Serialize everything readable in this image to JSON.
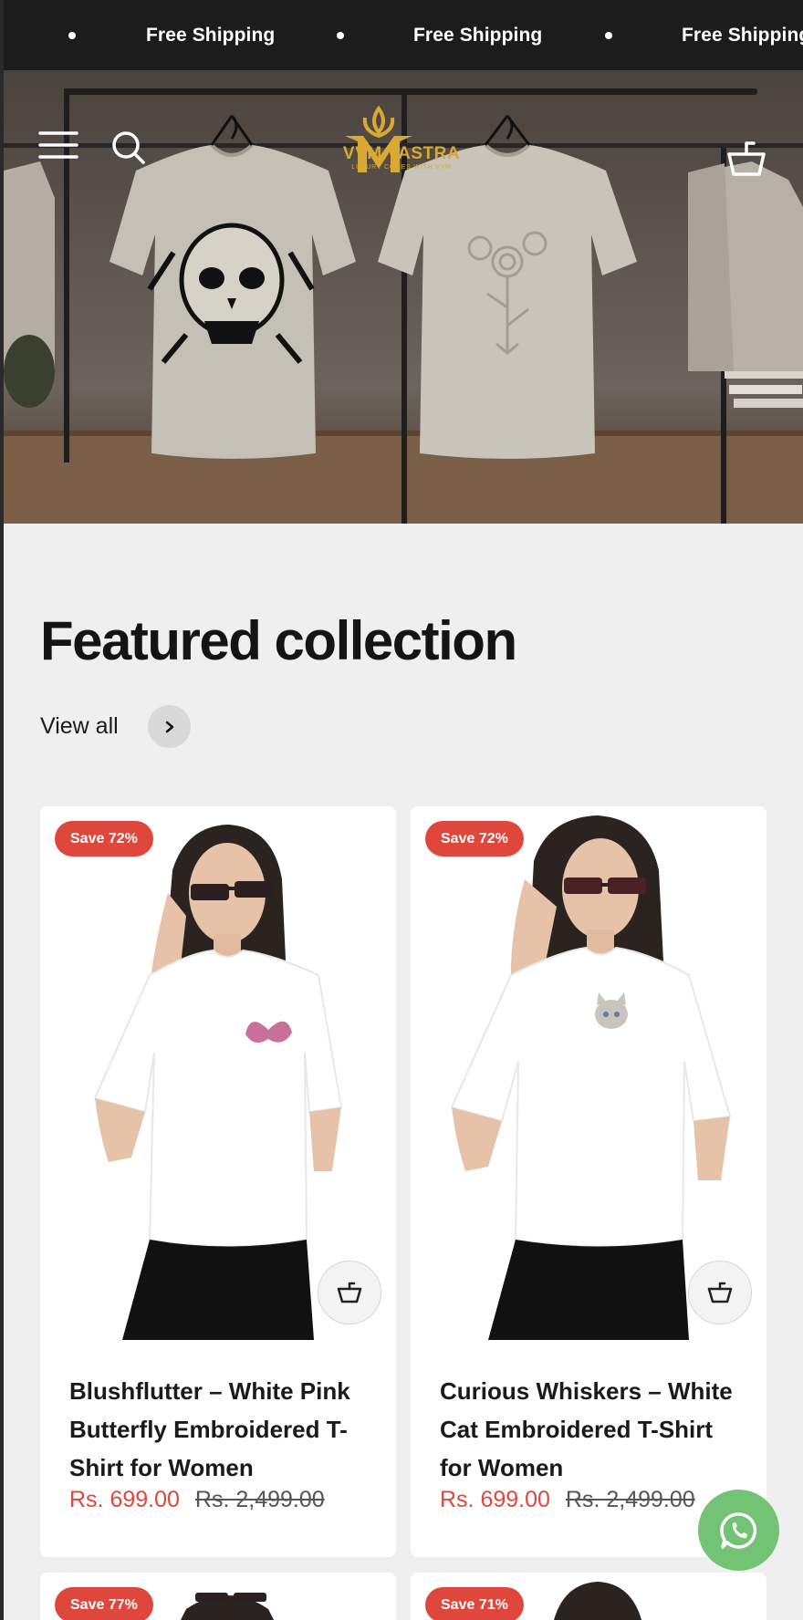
{
  "announcement": {
    "items": [
      "Free Shipping",
      "Free Shipping",
      "Free Shipping"
    ]
  },
  "header": {
    "logo_text": "VVM VASTRA",
    "logo_tagline": "LUXURY COMES WITH VVM",
    "icons": [
      "menu-icon",
      "search-icon",
      "cart-icon"
    ]
  },
  "featured": {
    "title": "Featured collection",
    "view_all_label": "View all"
  },
  "products": [
    {
      "badge": "Save 72%",
      "title": "Blushflutter – White Pink Butterfly Embroidered T-Shirt for Women",
      "price": "Rs. 699.00",
      "compare_price": "Rs. 2,499.00"
    },
    {
      "badge": "Save 72%",
      "title": "Curious Whiskers – White Cat Embroidered T-Shirt for Women",
      "price": "Rs. 699.00",
      "compare_price": "Rs. 2,499.00"
    },
    {
      "badge": "Save 77%"
    },
    {
      "badge": "Save 71%"
    }
  ],
  "colors": {
    "accent_sale": "#e0473c",
    "announcement_bg": "#1c1c1c",
    "whatsapp": "#73c374",
    "logo_gold": "#d9a934"
  }
}
